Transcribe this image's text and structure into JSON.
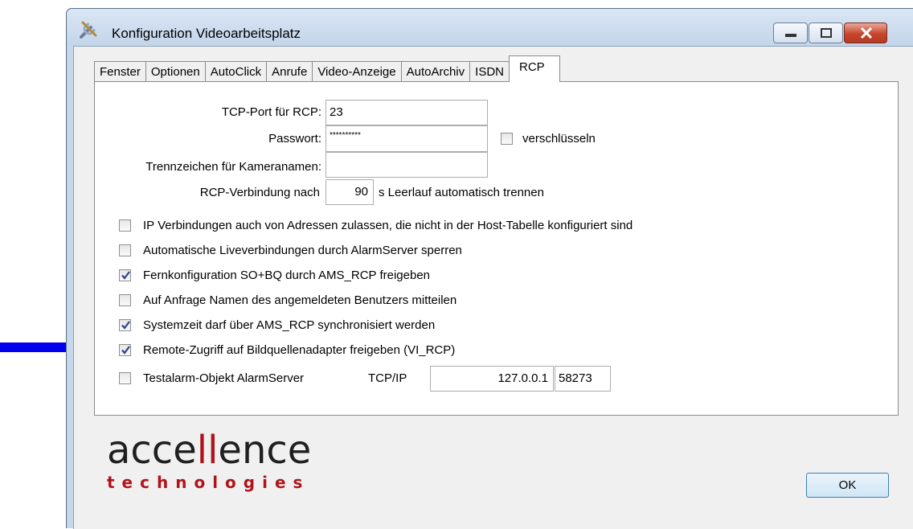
{
  "window": {
    "title": "Konfiguration Videoarbeitsplatz"
  },
  "tabs": [
    "Fenster",
    "Optionen",
    "AutoClick",
    "Anrufe",
    "Video-Anzeige",
    "AutoArchiv",
    "ISDN",
    "RCP"
  ],
  "active_tab": "RCP",
  "form": {
    "tcp_port_label": "TCP-Port für RCP:",
    "tcp_port_value": "23",
    "password_label": "Passwort:",
    "password_value": "**********",
    "encrypt_label": "verschlüsseln",
    "separator_label": "Trennzeichen für Kameranamen:",
    "separator_value": "",
    "rcp_conn_label": "RCP-Verbindung nach",
    "rcp_conn_value": "90",
    "rcp_conn_suffix": "s Leerlauf automatisch trennen"
  },
  "options": [
    {
      "label": "IP Verbindungen auch von Adressen zulassen, die nicht in der Host-Tabelle konfiguriert sind",
      "checked": false
    },
    {
      "label": "Automatische Liveverbindungen durch AlarmServer sperren",
      "checked": false
    },
    {
      "label": "Fernkonfiguration SO+BQ durch AMS_RCP freigeben",
      "checked": true
    },
    {
      "label": "Auf Anfrage Namen des angemeldeten Benutzers mitteilen",
      "checked": false
    },
    {
      "label": "Systemzeit darf über AMS_RCP synchronisiert werden",
      "checked": true
    },
    {
      "label": "Remote-Zugriff auf Bildquellenadapter freigeben (VI_RCP)",
      "checked": true
    }
  ],
  "testalarm": {
    "label": "Testalarm-Objekt AlarmServer",
    "checked": false,
    "protocol_label": "TCP/IP",
    "ip_value": "127.0.0.1",
    "port_value": "58273"
  },
  "logo": {
    "main_prefix": "acce",
    "main_highlight": "ll",
    "main_suffix": "ence",
    "sub": "technologies"
  },
  "buttons": {
    "ok_label": "OK"
  },
  "colors": {
    "arrow": "#0000ee",
    "logo_red": "#b0141b",
    "checkmark": "#2c3f8f"
  }
}
